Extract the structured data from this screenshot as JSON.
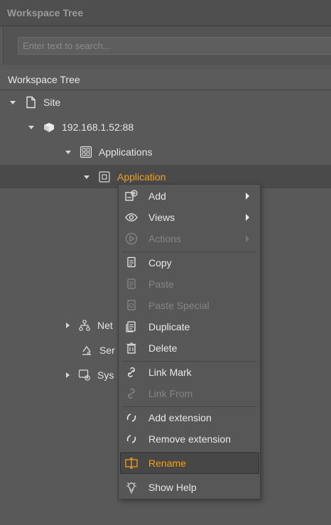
{
  "panel": {
    "title": "Workspace Tree"
  },
  "search": {
    "placeholder": "Enter text to search..."
  },
  "tree": {
    "section_title": "Workspace Tree",
    "site": "Site",
    "server": "192.168.1.52:88",
    "applications": "Applications",
    "application": "Application",
    "networks_partial": "Net",
    "services_partial": "Ser",
    "system_partial": "Sys"
  },
  "context_menu": {
    "items": [
      {
        "label": "Add",
        "icon": "add-icon",
        "disabled": false,
        "submenu": true
      },
      {
        "label": "Views",
        "icon": "eye-icon",
        "disabled": false,
        "submenu": true
      },
      {
        "label": "Actions",
        "icon": "play-icon",
        "disabled": true,
        "submenu": true
      },
      {
        "label": "Copy",
        "icon": "copy-icon",
        "disabled": false
      },
      {
        "label": "Paste",
        "icon": "paste-icon",
        "disabled": true
      },
      {
        "label": "Paste Special",
        "icon": "paste-special-icon",
        "disabled": true
      },
      {
        "label": "Duplicate",
        "icon": "duplicate-icon",
        "disabled": false
      },
      {
        "label": "Delete",
        "icon": "trash-icon",
        "disabled": false
      },
      {
        "label": "Link Mark",
        "icon": "link-icon",
        "disabled": false
      },
      {
        "label": "Link From",
        "icon": "link-icon",
        "disabled": true
      },
      {
        "label": "Add extension",
        "icon": "extension-icon",
        "disabled": false
      },
      {
        "label": "Remove extension",
        "icon": "extension-icon",
        "disabled": false
      },
      {
        "label": "Rename",
        "icon": "rename-icon",
        "disabled": false,
        "highlighted": true
      },
      {
        "label": "Show Help",
        "icon": "help-icon",
        "disabled": false
      }
    ]
  },
  "colors": {
    "accent": "#f0a119",
    "background": "#595959"
  }
}
